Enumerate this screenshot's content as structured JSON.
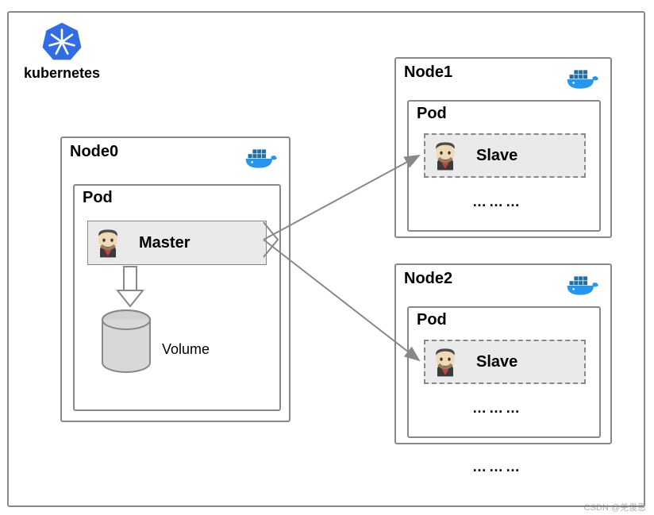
{
  "logo": {
    "text": "kubernetes"
  },
  "node0": {
    "title": "Node0",
    "pod": {
      "title": "Pod",
      "box": {
        "label": "Master"
      }
    },
    "volume_label": "Volume"
  },
  "node1": {
    "title": "Node1",
    "pod": {
      "title": "Pod",
      "box": {
        "label": "Slave"
      }
    },
    "dots": "………"
  },
  "node2": {
    "title": "Node2",
    "pod": {
      "title": "Pod",
      "box": {
        "label": "Slave"
      }
    },
    "dots": "………"
  },
  "dots_bottom": "………",
  "watermark": "CSDN @羌俊恩"
}
